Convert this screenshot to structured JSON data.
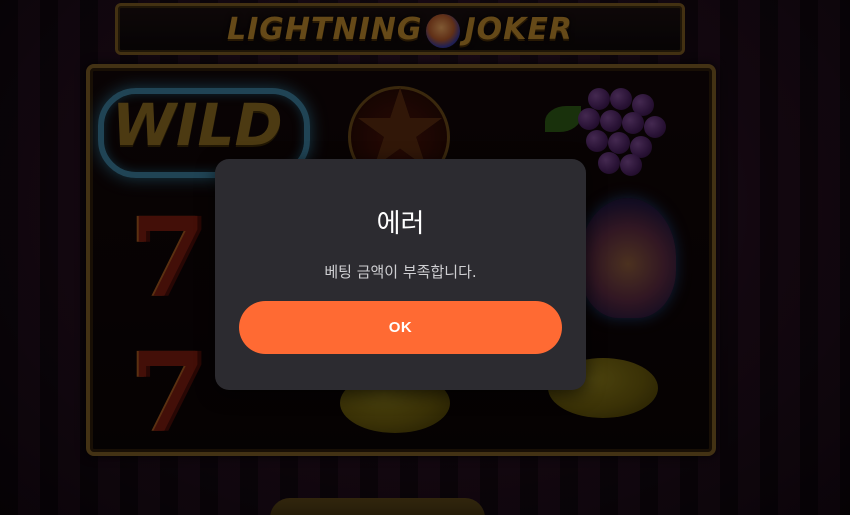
{
  "game": {
    "title_left": "LIGHTNING",
    "title_right": "JOKER",
    "symbols": [
      "WILD",
      "star",
      "grapes",
      "seven",
      "seven",
      "joker",
      "lemon",
      "lemon"
    ]
  },
  "dialog": {
    "title": "에러",
    "message": "베팅 금액이 부족합니다.",
    "ok_label": "OK"
  },
  "colors": {
    "accent": "#ff6a33",
    "dialog_bg": "#2c2b30",
    "frame_gold": "#7b5b25"
  }
}
